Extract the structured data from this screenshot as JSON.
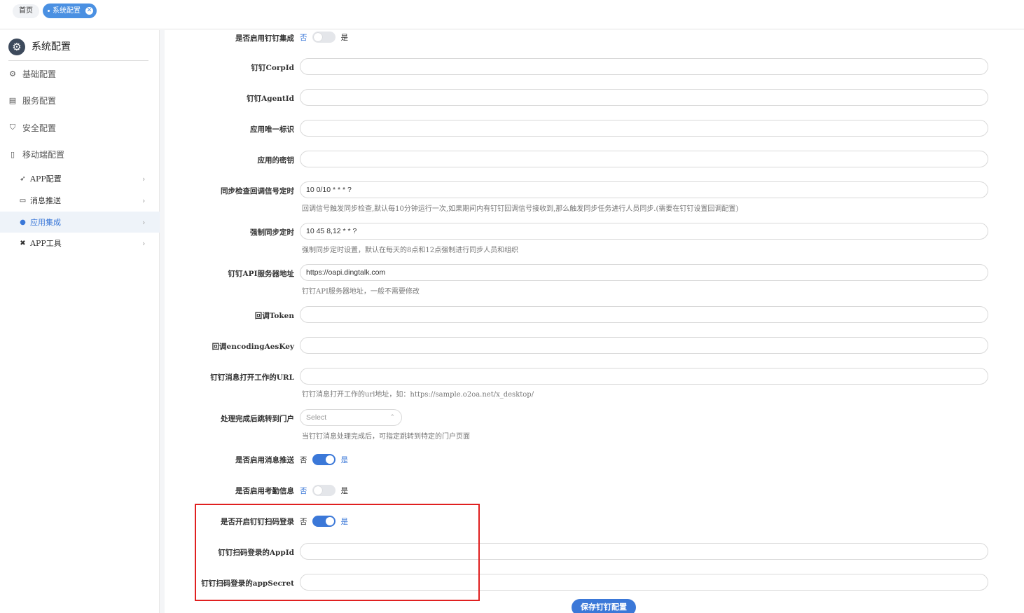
{
  "tabs": {
    "home": "首页",
    "active": "系统配置"
  },
  "sidebar": {
    "title": "系统配置",
    "items": [
      {
        "label": "基础配置",
        "icon": "gear-icon"
      },
      {
        "label": "服务配置",
        "icon": "server-icon"
      },
      {
        "label": "安全配置",
        "icon": "shield-icon"
      },
      {
        "label": "移动端配置",
        "icon": "mobile-icon"
      }
    ],
    "subitems": [
      {
        "label": "APP配置",
        "icon": "rocket-icon"
      },
      {
        "label": "消息推送",
        "icon": "message-icon"
      },
      {
        "label": "应用集成",
        "icon": "integration-icon",
        "active": true
      },
      {
        "label": "APP工具",
        "icon": "tools-icon"
      }
    ]
  },
  "form": {
    "enable_dingtalk": {
      "label": "是否启用钉钉集成",
      "off": "否",
      "on": "是",
      "value": false
    },
    "corpid": {
      "label": "钉钉CorpId",
      "value": ""
    },
    "agentid": {
      "label": "钉钉AgentId",
      "value": ""
    },
    "app_key": {
      "label": "应用唯一标识",
      "value": ""
    },
    "app_secret": {
      "label": "应用的密钥",
      "value": ""
    },
    "sync_check_cron": {
      "label": "同步检查回调信号定时",
      "value": "10 0/10 * * * ?",
      "hint": "回调信号触发同步检查,默认每10分钟运行一次,如果期间内有钉钉回调信号接收到,那么触发同步任务进行人员同步.(需要在钉钉设置回调配置)"
    },
    "force_sync_cron": {
      "label": "强制同步定时",
      "value": "10 45 8,12 * * ?",
      "hint": "强制同步定时设置，默认在每天的8点和12点强制进行同步人员和组织"
    },
    "api_address": {
      "label": "钉钉API服务器地址",
      "value": "https://oapi.dingtalk.com",
      "hint": "钉钉API服务器地址，一般不需要修改"
    },
    "callback_token": {
      "label": "回调Token",
      "value": ""
    },
    "callback_aes_key": {
      "label": "回调encodingAesKey",
      "value": ""
    },
    "message_url": {
      "label": "钉钉消息打开工作的URL",
      "value": "",
      "hint": "钉钉消息打开工作的url地址，如：https://sample.o2oa.net/x_desktop/"
    },
    "redirect_portal": {
      "label": "处理完成后跳转到门户",
      "placeholder": "Select",
      "hint": "当钉钉消息处理完成后，可指定跳转到特定的门户页面"
    },
    "enable_message_push": {
      "label": "是否启用消息推送",
      "off": "否",
      "on": "是",
      "value": true
    },
    "enable_attendance": {
      "label": "是否启用考勤信息",
      "off": "否",
      "on": "是",
      "value": false
    },
    "enable_scan_login": {
      "label": "是否开启钉钉扫码登录",
      "off": "否",
      "on": "是",
      "value": true
    },
    "scan_login_appid": {
      "label": "钉钉扫码登录的AppId",
      "value": ""
    },
    "scan_login_appsecret": {
      "label": "钉钉扫码登录的appSecret",
      "value": ""
    },
    "save_label": "保存钉钉配置"
  },
  "colors": {
    "accent": "#3b78d8",
    "highlight": "#e02020"
  }
}
